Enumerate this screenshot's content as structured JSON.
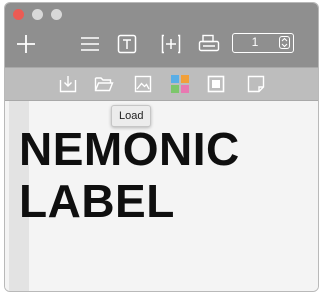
{
  "toolbar": {
    "add_icon": "plus-icon",
    "menu_icon": "hamburger-icon",
    "text_icon": "text-box-icon",
    "insert_icon": "plus-box-icon",
    "print_icon": "printer-icon",
    "copies_value": "1"
  },
  "secondary_toolbar": {
    "items": [
      {
        "name": "download-icon"
      },
      {
        "name": "folder-icon"
      },
      {
        "name": "image-icon"
      },
      {
        "name": "color-grid-icon"
      },
      {
        "name": "frame-icon"
      },
      {
        "name": "page-icon"
      }
    ]
  },
  "tooltip": {
    "text": "Load"
  },
  "label": {
    "line1": "NEMONIC",
    "line2": "LABEL"
  },
  "colors": {
    "toolbar": "#8f8f8f",
    "secondary_toolbar": "#bdbdbd",
    "close": "#eb5b54",
    "grid_blue": "#5aaee6",
    "grid_orange": "#f2a03a",
    "grid_green": "#7cc66b",
    "grid_pink": "#e879b1"
  }
}
